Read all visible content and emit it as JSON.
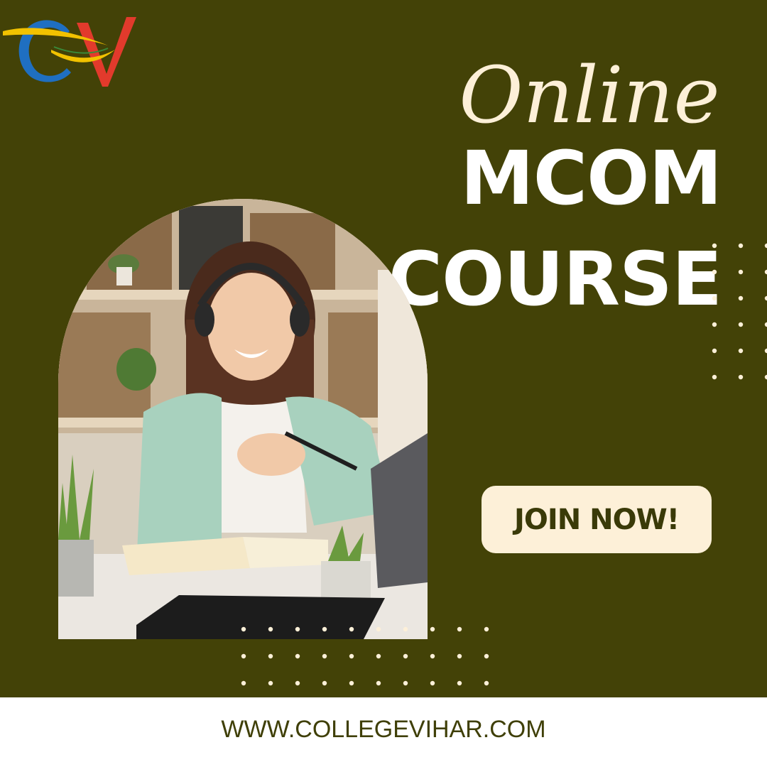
{
  "brand": {
    "logo_text": "CV",
    "colors": {
      "blue": "#1f6fc1",
      "red": "#e23a2c",
      "yellow": "#f2c200",
      "green": "#3a8a3a"
    }
  },
  "hero": {
    "script_word": "Online",
    "title_line1": "MCOM",
    "title_line2": "COURSE",
    "photo_icon": "student-with-headphones-photo"
  },
  "cta": {
    "label": "JOIN NOW!"
  },
  "footer": {
    "url": "WWW.COLLEGEVIHAR.COM"
  },
  "colors": {
    "background": "#434207",
    "cream": "#fdf0d8",
    "text_dark": "#3a3a08",
    "white": "#ffffff"
  }
}
